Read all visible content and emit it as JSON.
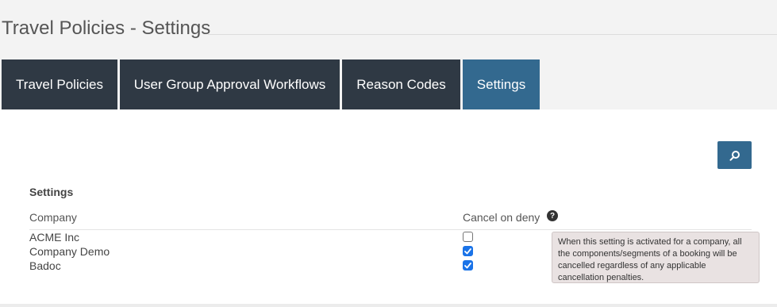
{
  "page": {
    "title": "Travel Policies - Settings"
  },
  "tabs": [
    {
      "label": "Travel Policies",
      "active": false
    },
    {
      "label": "User Group Approval Workflows",
      "active": false
    },
    {
      "label": "Reason Codes",
      "active": false
    },
    {
      "label": "Settings",
      "active": true
    }
  ],
  "toolbar": {
    "search_icon": "search-icon"
  },
  "settings": {
    "section_title": "Settings",
    "columns": {
      "company": "Company",
      "cancel_on_deny": "Cancel on deny"
    },
    "help_icon_glyph": "?",
    "rows": [
      {
        "company": "ACME Inc",
        "cancel_on_deny": false
      },
      {
        "company": "Company Demo",
        "cancel_on_deny": true
      },
      {
        "company": "Badoc",
        "cancel_on_deny": true
      }
    ],
    "tooltip": "When this setting is activated for a company, all the components/segments of a booking will be cancelled regardless of any applicable cancellation penalties."
  },
  "colors": {
    "tab_bg": "#2f3944",
    "tab_active_bg": "#33698f",
    "checkbox_checked": "#1a73e8"
  }
}
